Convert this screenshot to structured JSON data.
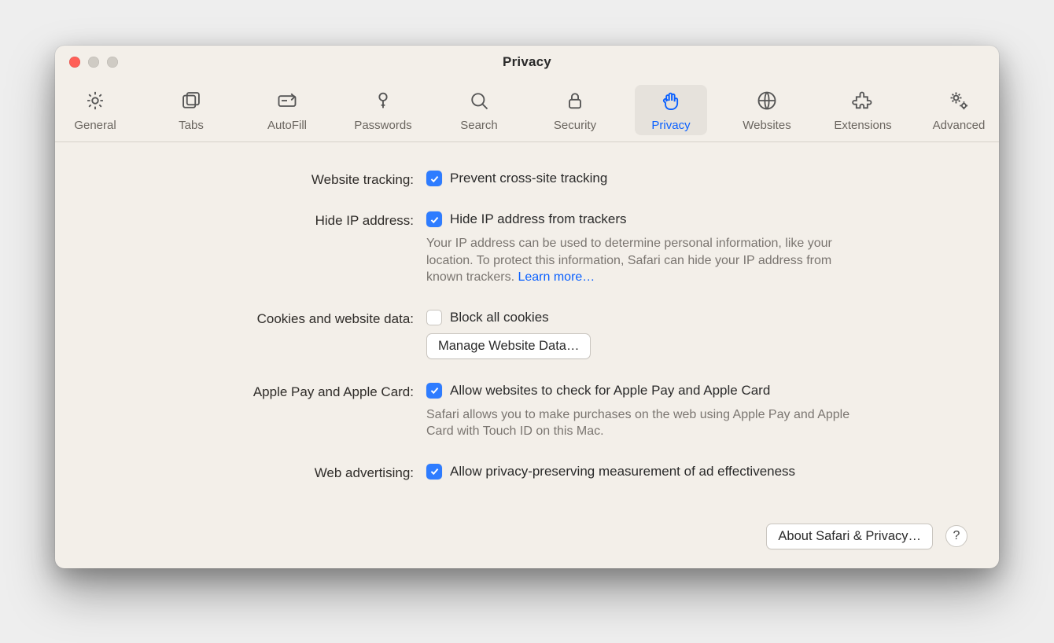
{
  "window": {
    "title": "Privacy"
  },
  "toolbar": {
    "items": [
      {
        "id": "general",
        "label": "General",
        "icon": "gear-icon"
      },
      {
        "id": "tabs",
        "label": "Tabs",
        "icon": "tabs-icon"
      },
      {
        "id": "autofill",
        "label": "AutoFill",
        "icon": "autofill-icon"
      },
      {
        "id": "passwords",
        "label": "Passwords",
        "icon": "key-icon"
      },
      {
        "id": "search",
        "label": "Search",
        "icon": "magnifier-icon"
      },
      {
        "id": "security",
        "label": "Security",
        "icon": "lock-icon"
      },
      {
        "id": "privacy",
        "label": "Privacy",
        "icon": "hand-icon",
        "selected": true
      },
      {
        "id": "websites",
        "label": "Websites",
        "icon": "globe-icon"
      },
      {
        "id": "extensions",
        "label": "Extensions",
        "icon": "puzzle-icon"
      },
      {
        "id": "advanced",
        "label": "Advanced",
        "icon": "gears-icon"
      }
    ]
  },
  "settings": {
    "website_tracking": {
      "label": "Website tracking:",
      "checkbox_label": "Prevent cross-site tracking",
      "checked": true
    },
    "hide_ip": {
      "label": "Hide IP address:",
      "checkbox_label": "Hide IP address from trackers",
      "checked": true,
      "description": "Your IP address can be used to determine personal information, like your location. To protect this information, Safari can hide your IP address from known trackers. ",
      "learn_more": "Learn more…"
    },
    "cookies": {
      "label": "Cookies and website data:",
      "checkbox_label": "Block all cookies",
      "checked": false,
      "button": "Manage Website Data…"
    },
    "apple_pay": {
      "label": "Apple Pay and Apple Card:",
      "checkbox_label": "Allow websites to check for Apple Pay and Apple Card",
      "checked": true,
      "description": "Safari allows you to make purchases on the web using Apple Pay and Apple Card with Touch ID on this Mac."
    },
    "web_ads": {
      "label": "Web advertising:",
      "checkbox_label": "Allow privacy-preserving measurement of ad effectiveness",
      "checked": true
    }
  },
  "footer": {
    "about_button": "About Safari & Privacy…",
    "help": "?"
  }
}
